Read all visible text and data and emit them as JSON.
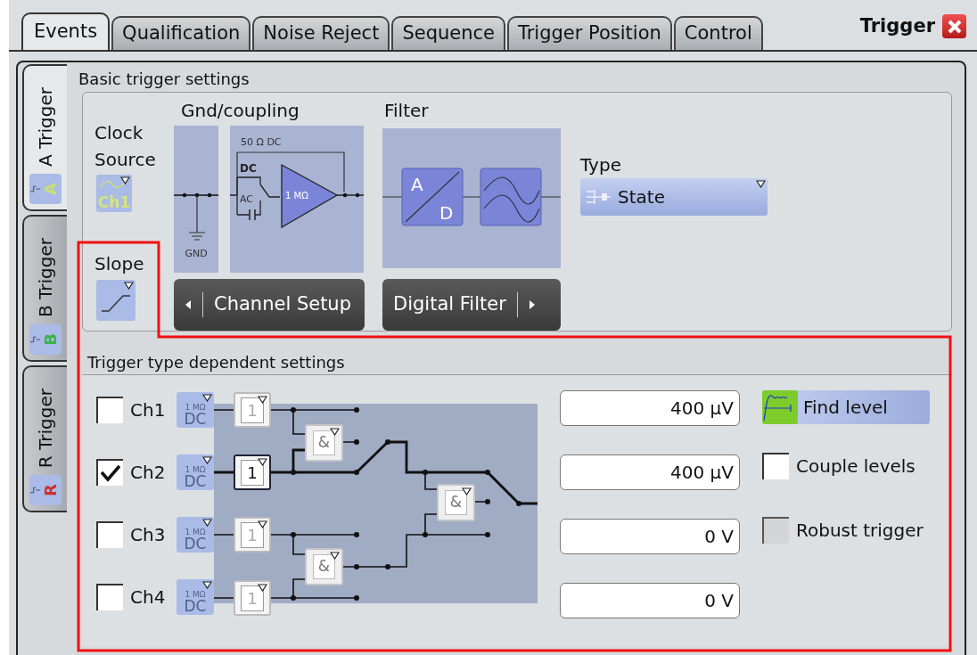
{
  "tabs": [
    {
      "label": "Events",
      "selected": true
    },
    {
      "label": "Qualification",
      "selected": false
    },
    {
      "label": "Noise Reject",
      "selected": false
    },
    {
      "label": "Sequence",
      "selected": false
    },
    {
      "label": "Trigger Position",
      "selected": false
    },
    {
      "label": "Control",
      "selected": false
    }
  ],
  "title": "Trigger",
  "side_tabs": [
    {
      "label": "A Trigger",
      "letter": "A",
      "color": "#c8e070",
      "selected": true
    },
    {
      "label": "B Trigger",
      "letter": "B",
      "color": "#3cb44a",
      "selected": false
    },
    {
      "label": "R Trigger",
      "letter": "R",
      "color": "#d03030",
      "selected": false
    }
  ],
  "basic": {
    "title": "Basic trigger settings",
    "clock_source": {
      "label": "Clock Source",
      "value": "Ch1"
    },
    "slope": {
      "label": "Slope"
    },
    "gnd_coupling": {
      "label": "Gnd/coupling",
      "gnd": "GND",
      "termination": "50 Ω DC",
      "dc": "DC",
      "ac": "AC",
      "amp": "1 MΩ",
      "button": "Channel Setup"
    },
    "filter": {
      "label": "Filter",
      "adc": [
        "A",
        "D"
      ],
      "button": "Digital Filter"
    },
    "type": {
      "label": "Type",
      "value": "State"
    }
  },
  "dependent": {
    "title": "Trigger type dependent settings",
    "channels": [
      {
        "label": "Ch1",
        "checked": false,
        "impedance": "1 MΩ",
        "coupling": "DC",
        "logic": "1"
      },
      {
        "label": "Ch2",
        "checked": true,
        "impedance": "1 MΩ",
        "coupling": "DC",
        "logic": "1"
      },
      {
        "label": "Ch3",
        "checked": false,
        "impedance": "1 MΩ",
        "coupling": "DC",
        "logic": "1"
      },
      {
        "label": "Ch4",
        "checked": false,
        "impedance": "1 MΩ",
        "coupling": "DC",
        "logic": "1"
      }
    ],
    "gates": [
      "&",
      "&",
      "&"
    ],
    "levels": [
      "400 µV",
      "400 µV",
      "0 V",
      "0 V"
    ],
    "find_level": "Find level",
    "options": [
      {
        "label": "Couple levels",
        "checked": false,
        "disabled": false
      },
      {
        "label": "Robust trigger",
        "checked": false,
        "disabled": true
      }
    ]
  }
}
